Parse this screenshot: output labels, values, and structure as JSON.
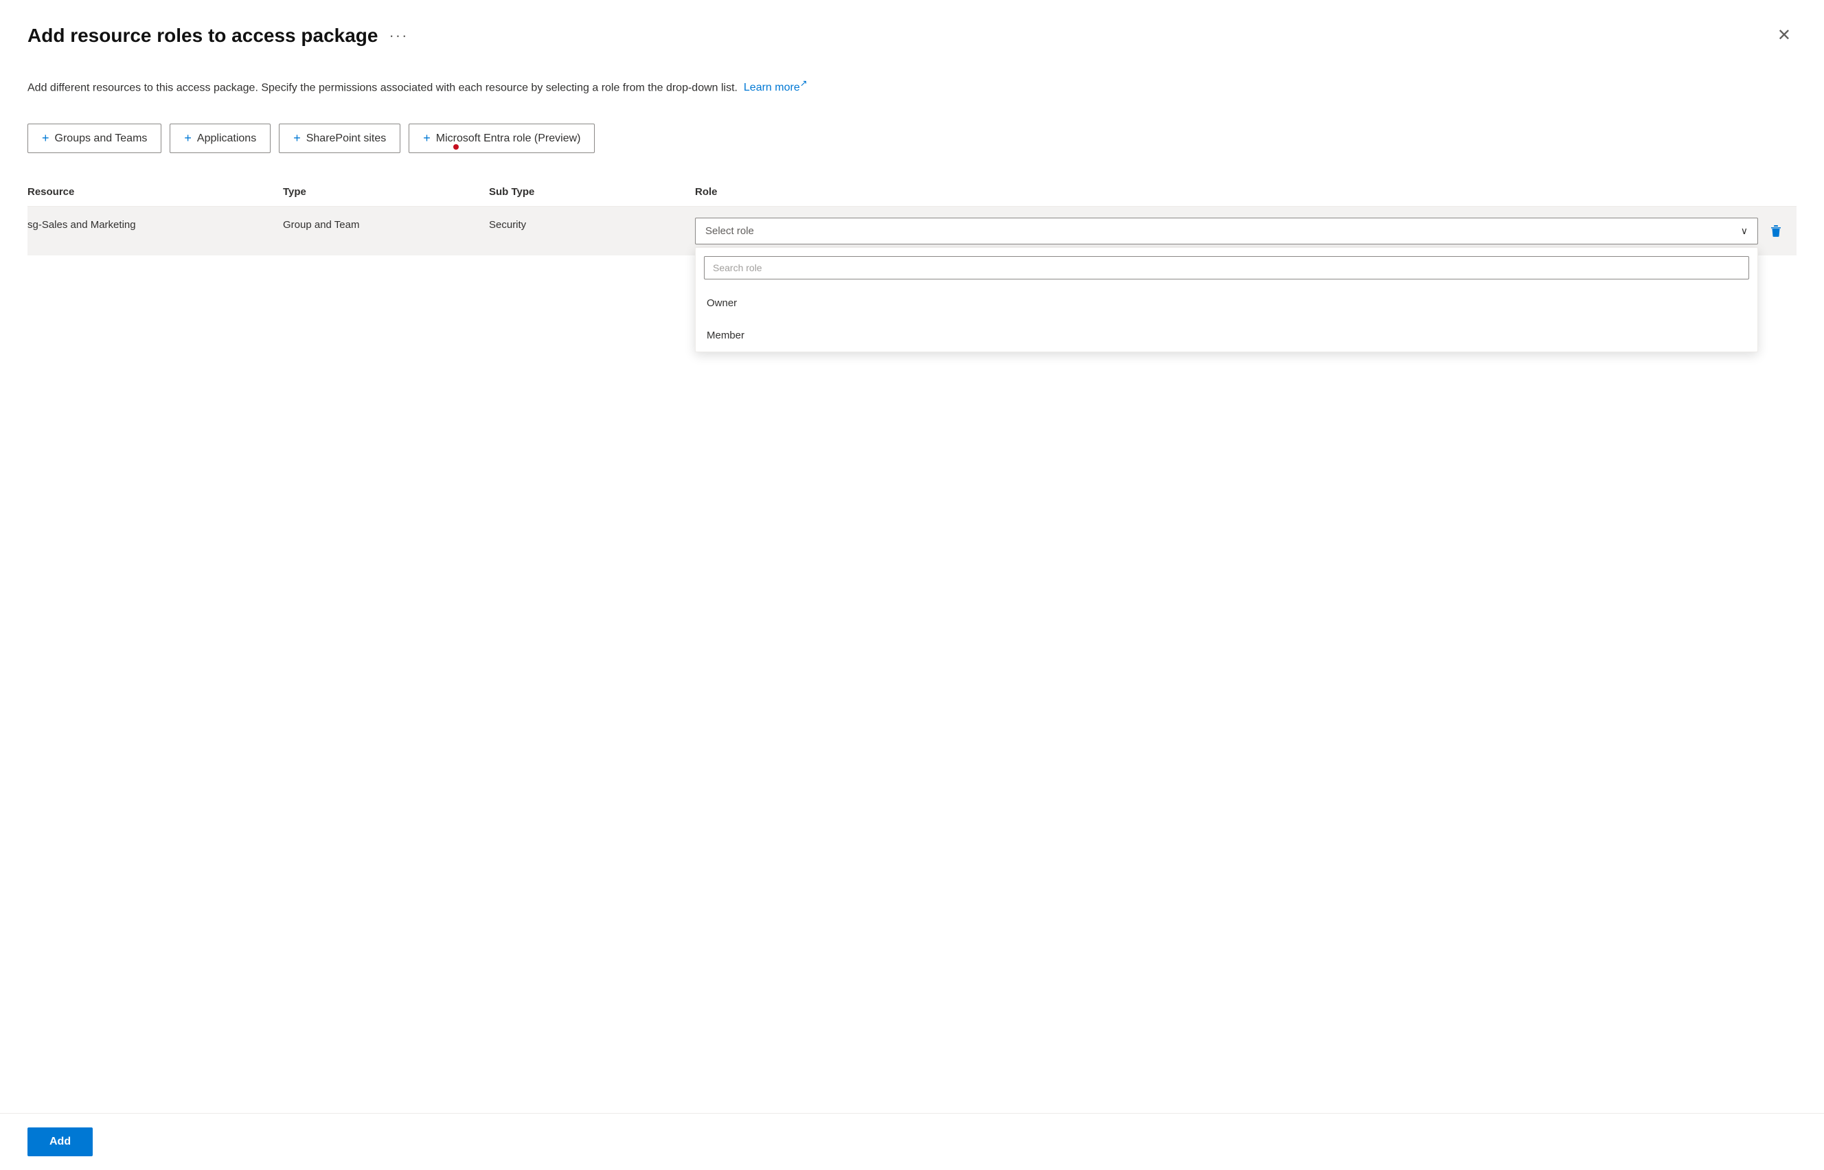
{
  "dialog": {
    "title": "Add resource roles to access package",
    "more_options_label": "···",
    "close_label": "✕",
    "description_text": "Add different resources to this access package. Specify the permissions associated with each resource by selecting a role from the drop-down list.",
    "learn_more_label": "Learn more",
    "learn_more_icon": "↗"
  },
  "tabs": [
    {
      "label": "Groups and Teams",
      "plus": "+"
    },
    {
      "label": "Applications",
      "plus": "+"
    },
    {
      "label": "SharePoint sites",
      "plus": "+"
    },
    {
      "label": "Microsoft Entra role (Preview)",
      "plus": "+"
    }
  ],
  "table": {
    "headers": {
      "resource": "Resource",
      "type": "Type",
      "sub_type": "Sub Type",
      "role": "Role"
    },
    "rows": [
      {
        "resource": "sg-Sales and Marketing",
        "type": "Group and Team",
        "sub_type": "Security"
      }
    ]
  },
  "role_select": {
    "placeholder": "Select role",
    "search_placeholder": "Search role",
    "options": [
      "Owner",
      "Member"
    ]
  },
  "footer": {
    "add_label": "Add"
  }
}
